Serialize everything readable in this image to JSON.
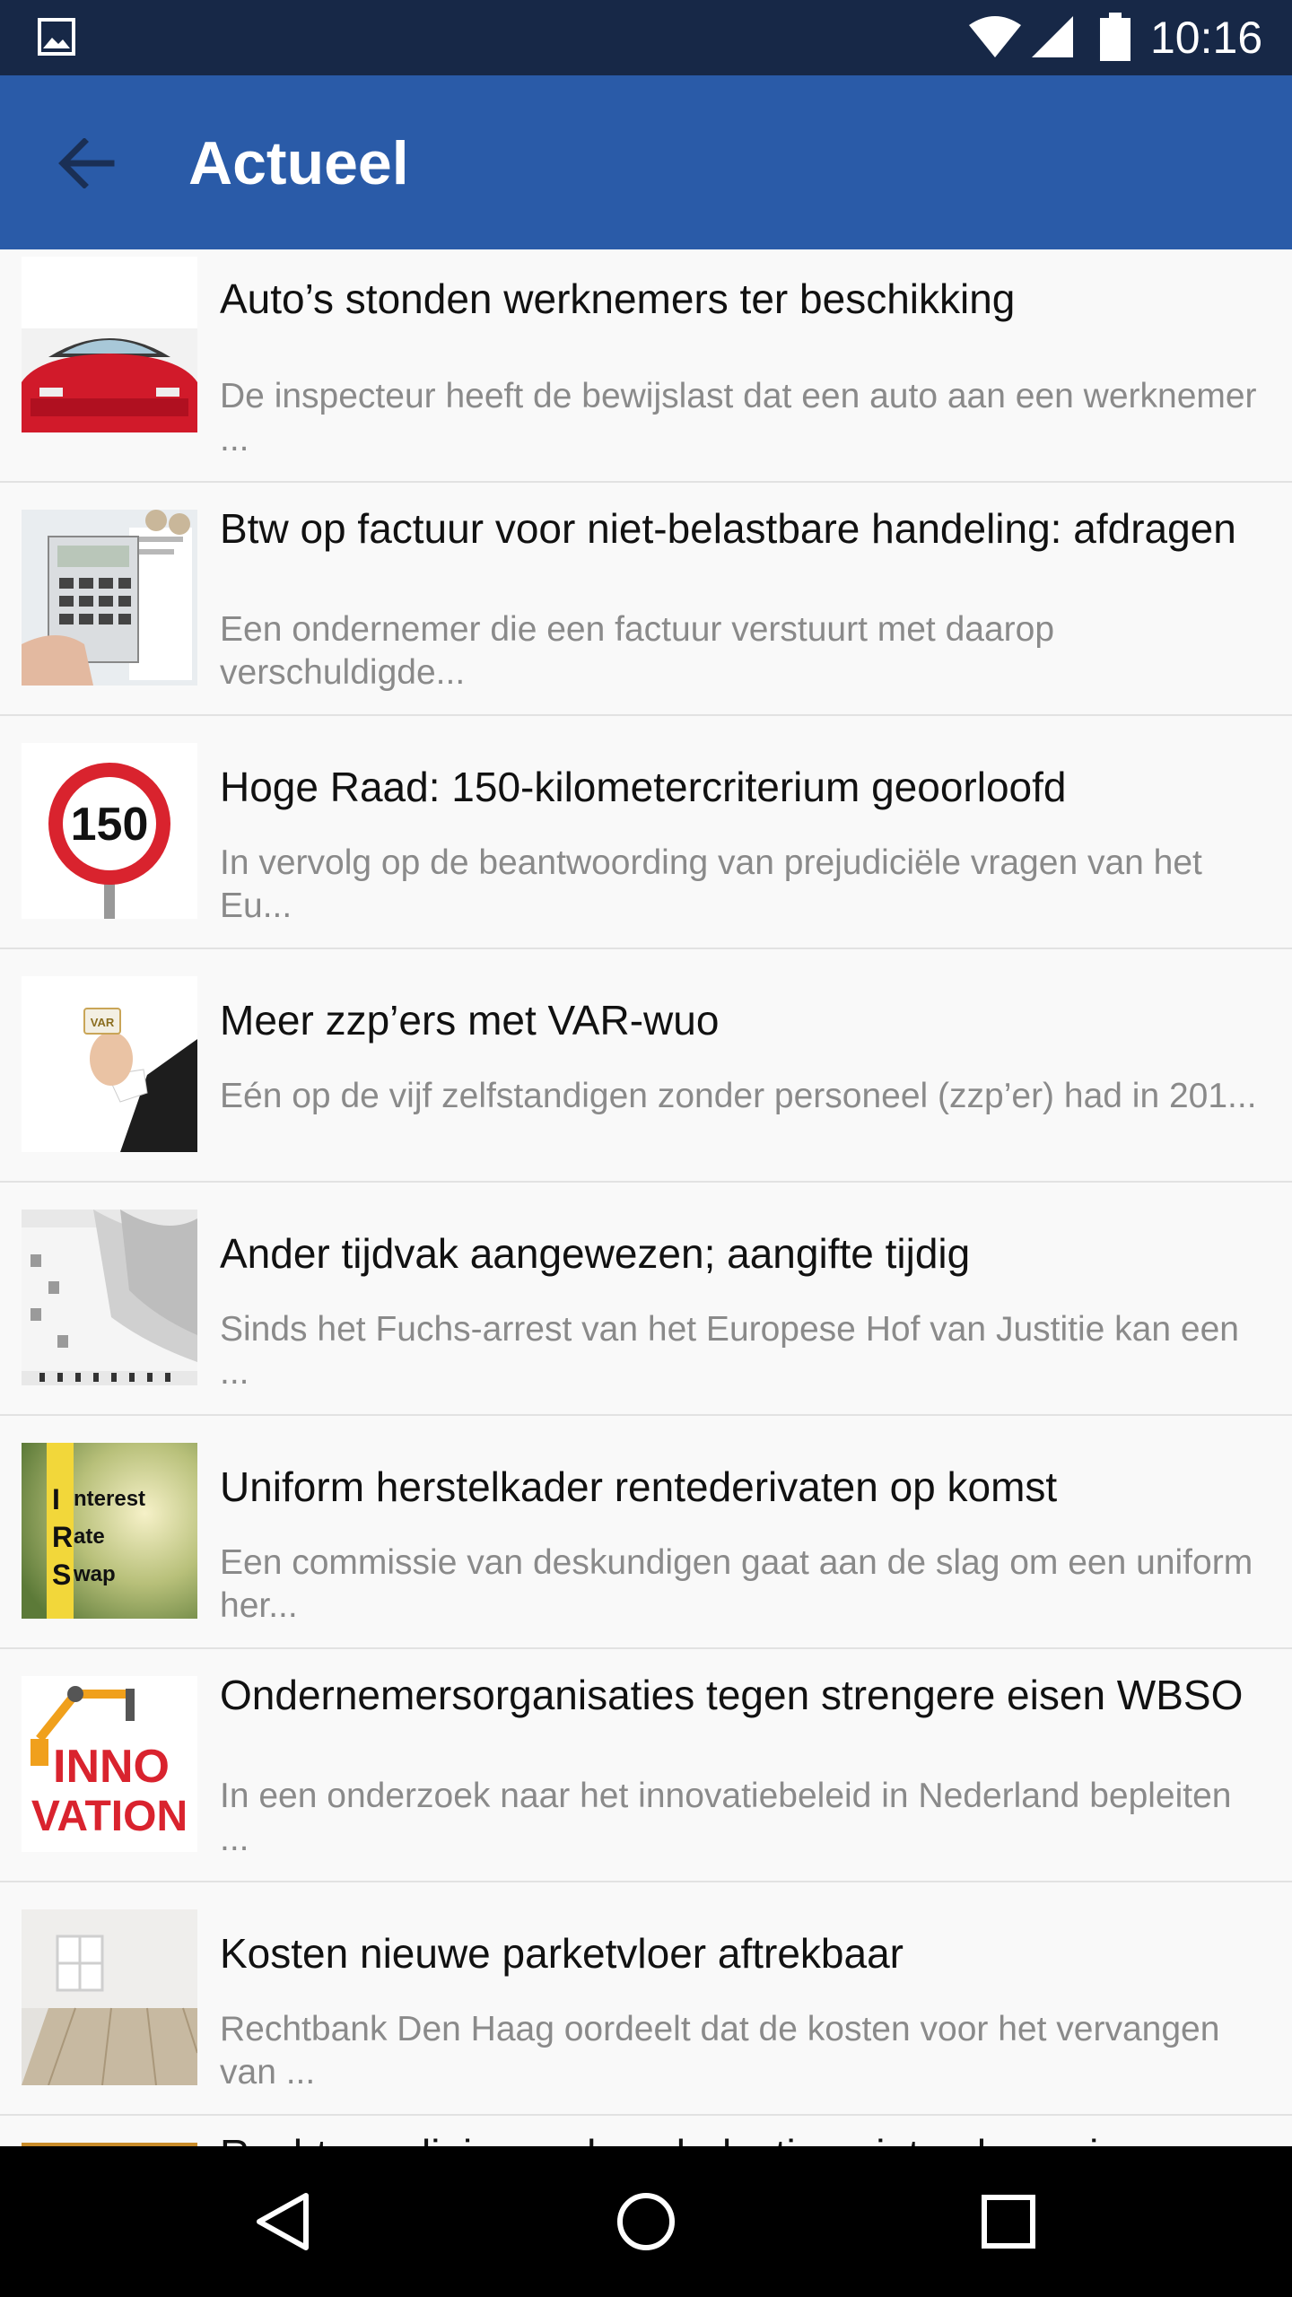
{
  "status_bar": {
    "time": "10:16",
    "icons": [
      "gallery-icon",
      "wifi-icon",
      "signal-icon",
      "battery-icon"
    ]
  },
  "app_bar": {
    "title": "Actueel",
    "back_icon": "arrow-back-icon",
    "background": "#2a5ba8"
  },
  "news": [
    {
      "title": "Auto’s stonden werknemers ter beschikking",
      "summary": "De inspecteur heeft de bewijslast dat een auto aan een werknemer ...",
      "thumb": "red-car-image"
    },
    {
      "title": "Btw op factuur voor niet-belastbare handeling: afdragen",
      "summary": "Een ondernemer die een factuur verstuurt met daarop verschuldigde...",
      "thumb": "calculator-image"
    },
    {
      "title": "Hoge Raad: 150-kilometercriterium geoorloofd",
      "summary": "In vervolg op de beantwoording van prejudiciële vragen van het Eu...",
      "thumb": "speed-sign-150-image",
      "thumb_text": "150"
    },
    {
      "title": "Meer zzp’ers met VAR-wuo",
      "summary": "Eén op de vijf zelfstandigen zonder personeel (zzp’er) had in 201...",
      "thumb": "hand-var-card-image",
      "thumb_text": "VAR"
    },
    {
      "title": "Ander tijdvak aangewezen; aangifte tijdig",
      "summary": "Sinds het Fuchs-arrest van het Europese Hof van Justitie kan een ...",
      "thumb": "calendar-image"
    },
    {
      "title": "Uniform herstelkader rentederivaten op komst",
      "summary": "Een commissie van deskundigen gaat aan de slag om een uniform her...",
      "thumb": "interest-rate-swap-image",
      "thumb_lines": [
        "I",
        "nterest",
        "R",
        "ate",
        "S",
        "wap"
      ]
    },
    {
      "title": "Ondernemersorganisaties tegen strengere eisen WBSO",
      "summary": "In een onderzoek naar het innovatiebeleid in Nederland bepleiten ...",
      "thumb": "innovation-image",
      "thumb_lines": [
        "INNO",
        "VATION"
      ]
    },
    {
      "title": "Kosten nieuwe parketvloer aftrekbaar",
      "summary": "Rechtbank Den Haag oordeelt dat de kosten voor het vervangen van ...",
      "thumb": "empty-room-image"
    },
    {
      "title": "Rechtvaardiging reclamebelasting niet gelegen in",
      "summary": "",
      "thumb": "partial-image"
    }
  ],
  "nav_bar": {
    "buttons": [
      "back-triangle-icon",
      "home-circle-icon",
      "recents-square-icon"
    ]
  }
}
